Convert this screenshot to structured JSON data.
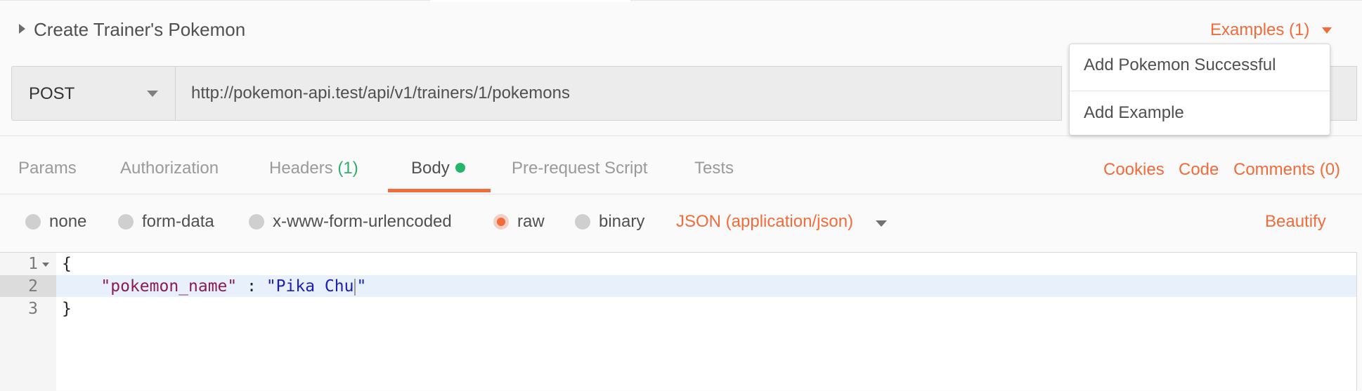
{
  "header": {
    "title": "Create Trainer's Pokemon",
    "examples_label": "Examples (1)"
  },
  "request": {
    "method": "POST",
    "url": "http://pokemon-api.test/api/v1/trainers/1/pokemons"
  },
  "examples_dropdown": {
    "items": [
      "Add Pokemon Successful",
      "Add Example"
    ]
  },
  "tabs": {
    "params": "Params",
    "authorization": "Authorization",
    "headers": "Headers",
    "headers_count": "(1)",
    "body": "Body",
    "prerequest": "Pre-request Script",
    "tests": "Tests",
    "active": "Body"
  },
  "right_links": {
    "cookies": "Cookies",
    "code": "Code",
    "comments": "Comments (0)"
  },
  "body_types": {
    "options": [
      "none",
      "form-data",
      "x-www-form-urlencoded",
      "raw",
      "binary"
    ],
    "selected": "raw",
    "content_type": "JSON (application/json)",
    "beautify": "Beautify"
  },
  "editor": {
    "line_numbers": [
      "1",
      "2",
      "3"
    ],
    "open_brace": "{",
    "key": "\"pokemon_name\"",
    "separator": " : ",
    "value_before_cursor": "\"Pika Chu",
    "value_after_cursor": "\"",
    "close_brace": "}"
  },
  "colors": {
    "accent": "#f26b3a",
    "success": "#26b56a",
    "json_key": "#8b1a5a",
    "json_string": "#1a1fb5"
  }
}
